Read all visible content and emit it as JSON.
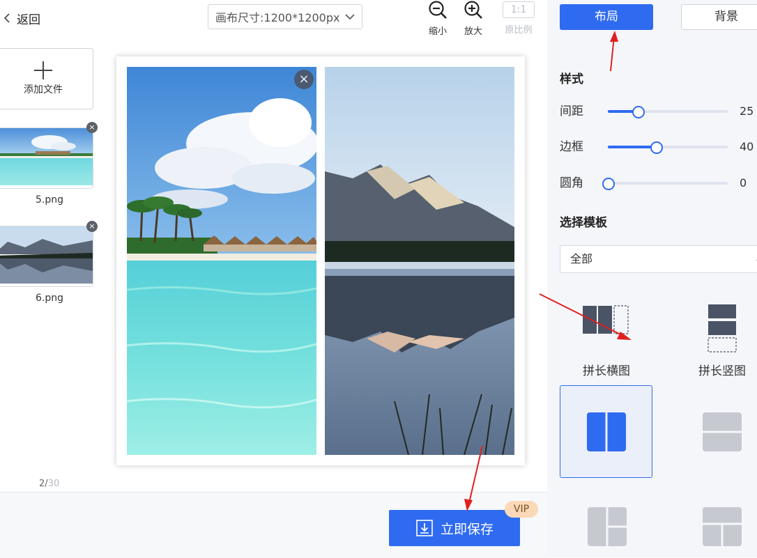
{
  "header": {
    "back_label": "返回",
    "canvas_size_label": "画布尺寸:1200*1200px",
    "tools": {
      "zoom_out_label": "缩小",
      "zoom_in_label": "放大",
      "ratio_value": "1:1",
      "ratio_label": "原比例"
    }
  },
  "file_panel": {
    "add_file_label": "添加文件",
    "files": [
      {
        "name": "5.png",
        "remove": "×"
      },
      {
        "name": "6.png",
        "remove": "×"
      }
    ],
    "page_current": "2",
    "page_separator": "/",
    "page_total": "30"
  },
  "canvas": {
    "close_label": "×"
  },
  "bottom": {
    "save_label": "立即保存",
    "vip_badge": "VIP"
  },
  "settings": {
    "tabs": {
      "layout": "布局",
      "background": "背景"
    },
    "style_title": "样式",
    "sliders": [
      {
        "label": "间距",
        "value": "25",
        "fraction": 0.25
      },
      {
        "label": "边框",
        "value": "40",
        "fraction": 0.4
      },
      {
        "label": "圆角",
        "value": "0",
        "fraction": 0
      }
    ],
    "template_title": "选择模板",
    "template_filter": "全部",
    "templates": [
      {
        "label": "拼长横图",
        "icon": "long-horizontal-icon"
      },
      {
        "label": "拼长竖图",
        "icon": "long-vertical-icon"
      }
    ]
  },
  "colors": {
    "accent": "#2f6bf0",
    "panel_bg": "#f5f6fa",
    "vip_bg": "#fbd9b8",
    "annotation_arrow": "#e02020"
  }
}
